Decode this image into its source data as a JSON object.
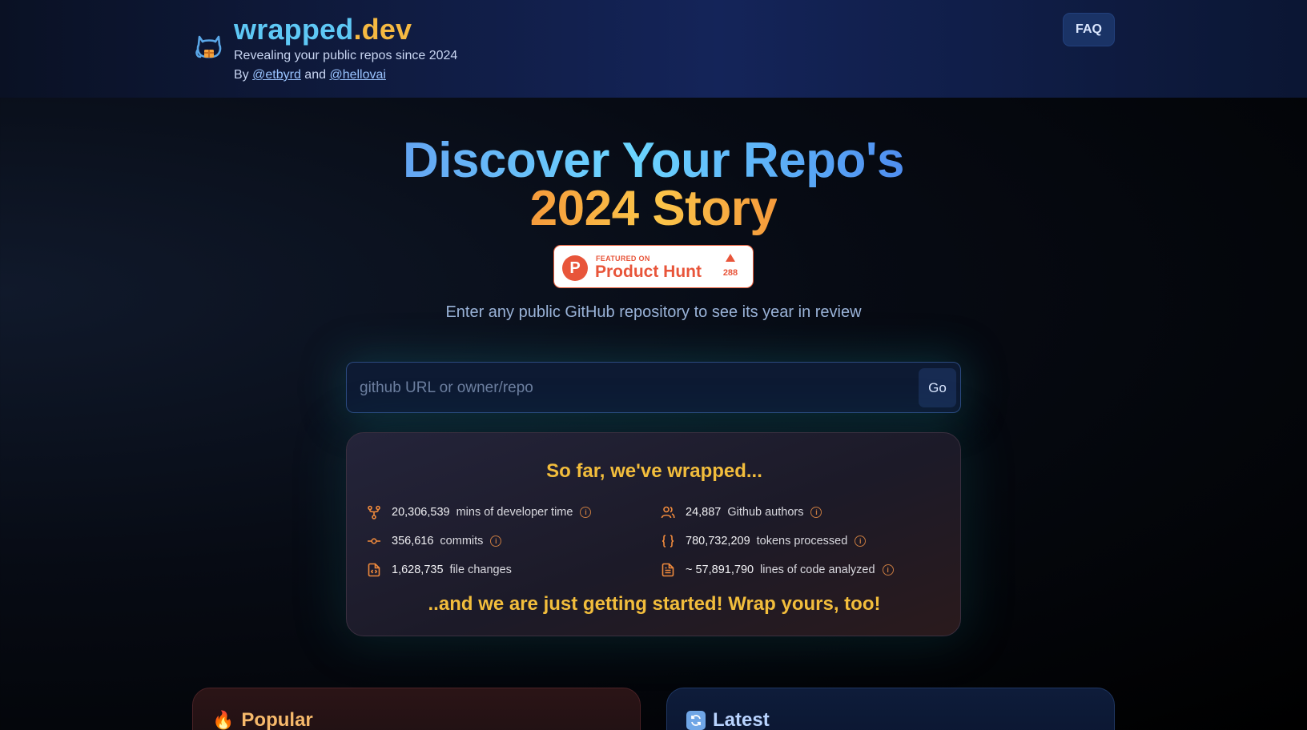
{
  "header": {
    "brand_main": "wrapped",
    "brand_tld": ".dev",
    "tagline": "Revealing your public repos since 2024",
    "by_prefix": "By",
    "author1": "@etbyrd",
    "and": "and",
    "author2": "@hellovai",
    "faq_label": "FAQ",
    "logo_icon": "octocat-gift-icon"
  },
  "hero": {
    "line1": "Discover Your Repo's",
    "line2": "2024 Story"
  },
  "product_hunt": {
    "featured": "FEATURED ON",
    "name": "Product Hunt",
    "logo_letter": "P",
    "upvotes": "288"
  },
  "subtitle": "Enter any public GitHub repository to see its year in review",
  "search": {
    "placeholder": "github URL or owner/repo",
    "value": "",
    "button_label": "Go"
  },
  "stats": {
    "title": "So far, we've wrapped...",
    "items": [
      {
        "icon": "git-fork-icon",
        "value": "20,306,539",
        "label": "mins of developer time"
      },
      {
        "icon": "users-icon",
        "value": "24,887",
        "label": "Github authors"
      },
      {
        "icon": "git-commit-icon",
        "value": "356,616",
        "label": "commits"
      },
      {
        "icon": "braces-icon",
        "value": "780,732,209",
        "label": "tokens processed"
      },
      {
        "icon": "file-code-icon",
        "value": "1,628,735",
        "label": "file changes"
      },
      {
        "icon": "file-text-icon",
        "value": "~ 57,891,790",
        "label": "lines of code analyzed"
      }
    ],
    "info_glyph": "i",
    "footer": "..and we are just getting started! Wrap yours, too!"
  },
  "panels": {
    "popular": {
      "emoji": "🔥",
      "title": "Popular"
    },
    "latest": {
      "emoji": "🔄",
      "title": "Latest"
    }
  },
  "colors": {
    "accent_orange": "#f08a3c",
    "accent_gold": "#f2bd3c",
    "accent_blue": "#5ec8f5",
    "product_hunt": "#e8553a"
  }
}
